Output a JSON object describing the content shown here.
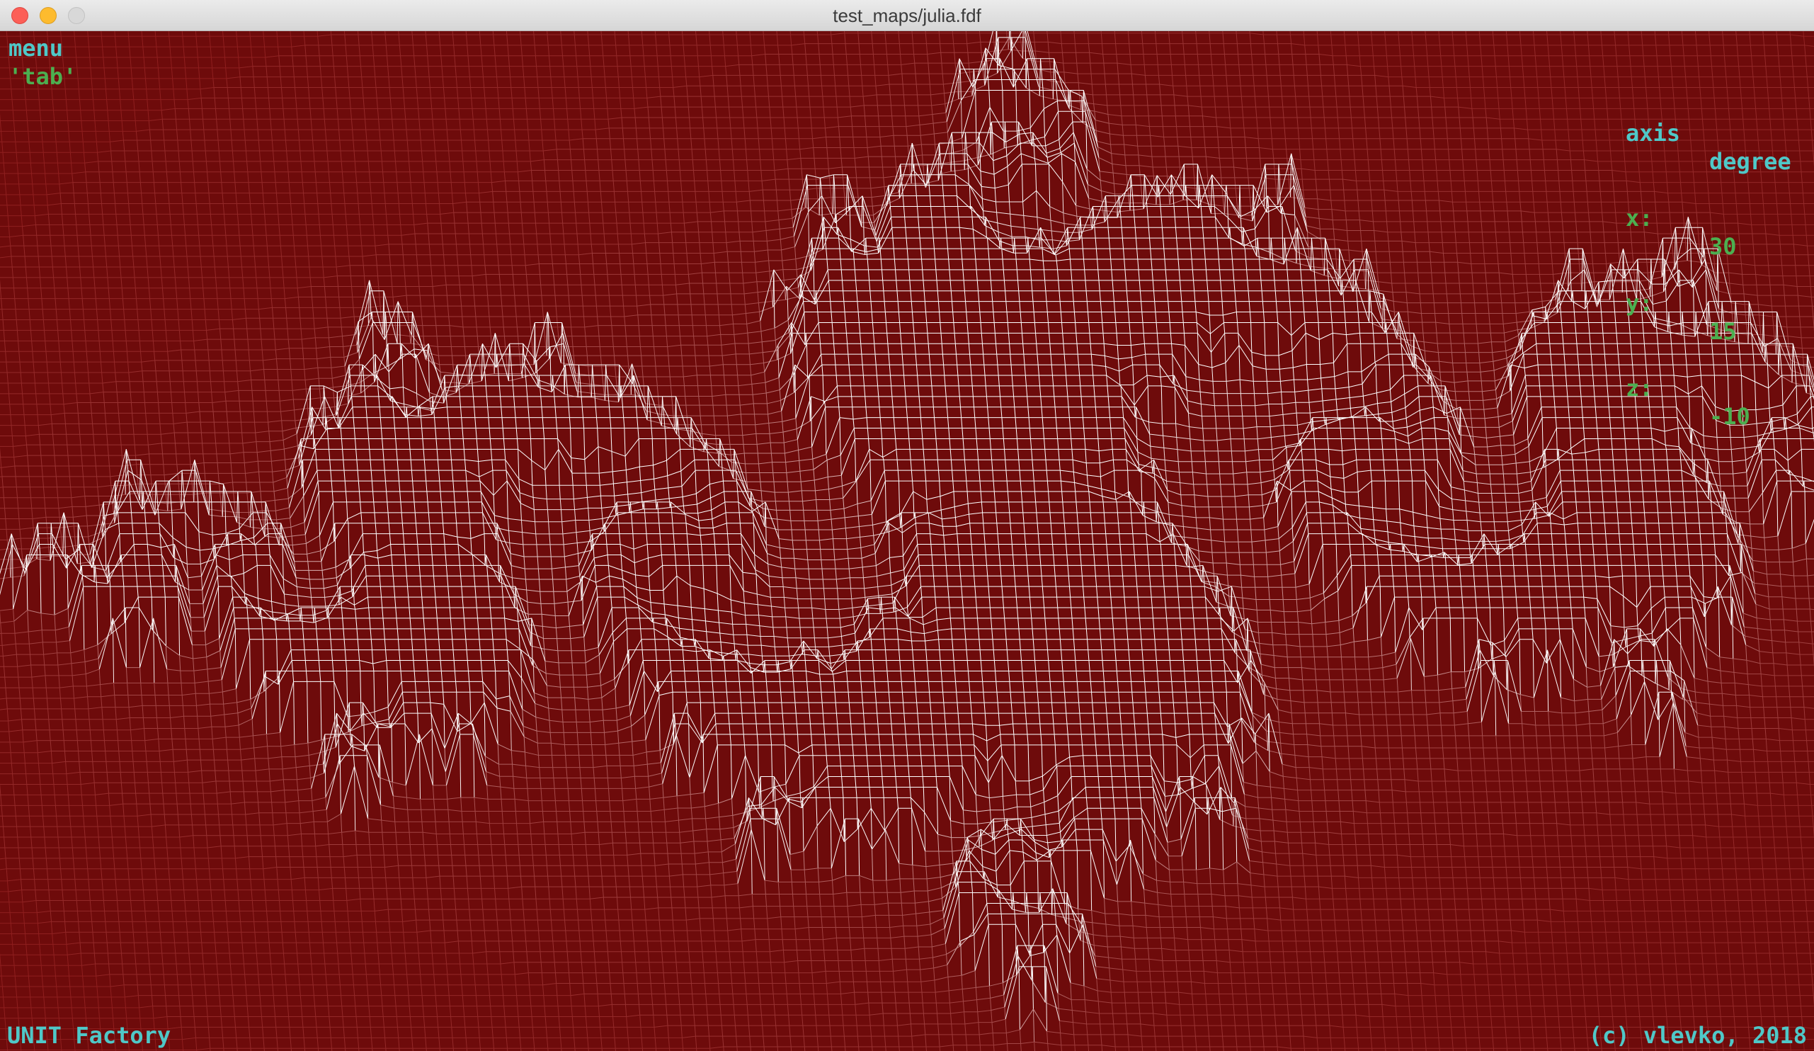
{
  "window": {
    "title": "test_maps/julia.fdf"
  },
  "hud": {
    "menu_label": "menu",
    "tab_hint": "'tab'",
    "axis_header": "axis",
    "degree_header": "degree",
    "rows": [
      {
        "axis": "x:",
        "degree": "30"
      },
      {
        "axis": "y:",
        "degree": "15"
      },
      {
        "axis": "z:",
        "degree": "-10"
      }
    ],
    "footer_left": "UNIT Factory",
    "footer_right": "(c) vlevko, 2018"
  },
  "colors": {
    "background": "#6e0b0b",
    "wire_low": "#8a1616",
    "wire_high": "#ffffff",
    "hud_cyan": "#4fc8c8",
    "hud_green": "#4caf50"
  }
}
